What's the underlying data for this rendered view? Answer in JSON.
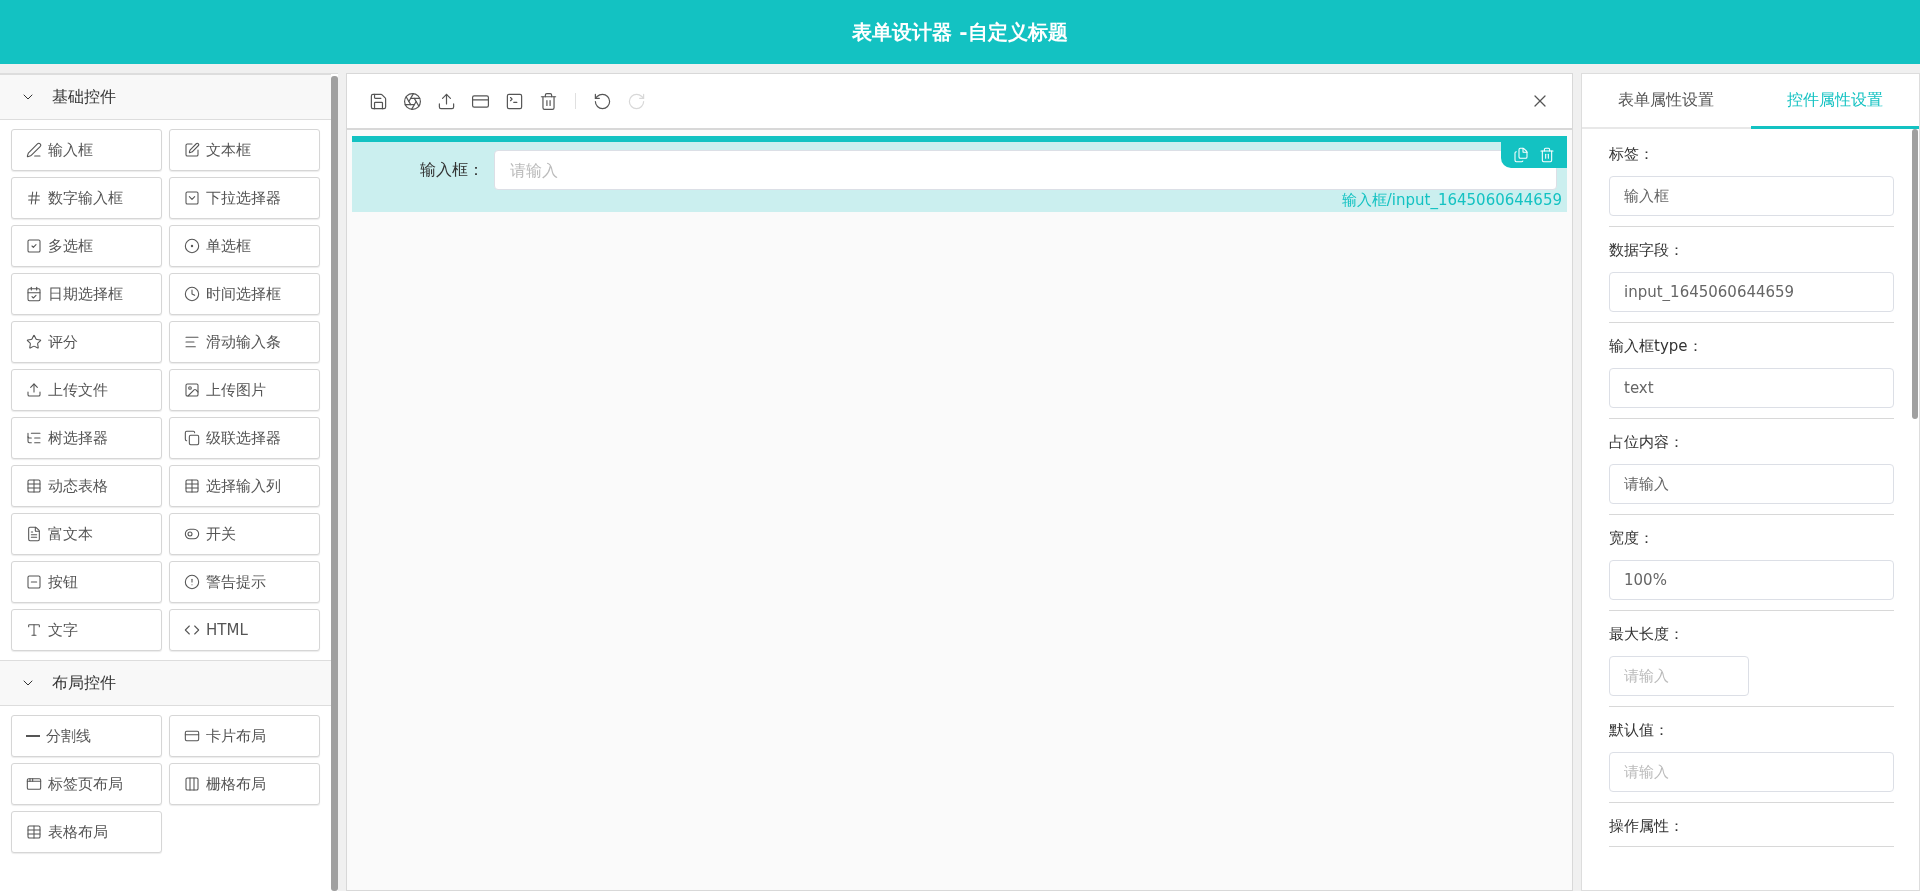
{
  "header": {
    "title": "表单设计器 -自定义标题"
  },
  "palette": {
    "sections": [
      {
        "title": "基础控件",
        "expanded": true,
        "widgets": [
          {
            "label": "输入框",
            "kind": "input"
          },
          {
            "label": "文本框",
            "kind": "textarea"
          },
          {
            "label": "数字输入框",
            "kind": "number"
          },
          {
            "label": "下拉选择器",
            "kind": "select"
          },
          {
            "label": "多选框",
            "kind": "checkbox"
          },
          {
            "label": "单选框",
            "kind": "radio"
          },
          {
            "label": "日期选择框",
            "kind": "date"
          },
          {
            "label": "时间选择框",
            "kind": "time"
          },
          {
            "label": "评分",
            "kind": "rate"
          },
          {
            "label": "滑动输入条",
            "kind": "slider"
          },
          {
            "label": "上传文件",
            "kind": "upload"
          },
          {
            "label": "上传图片",
            "kind": "image"
          },
          {
            "label": "树选择器",
            "kind": "tree"
          },
          {
            "label": "级联选择器",
            "kind": "cascader"
          },
          {
            "label": "动态表格",
            "kind": "table"
          },
          {
            "label": "选择输入列",
            "kind": "table"
          },
          {
            "label": "富文本",
            "kind": "editor"
          },
          {
            "label": "开关",
            "kind": "switch"
          },
          {
            "label": "按钮",
            "kind": "button"
          },
          {
            "label": "警告提示",
            "kind": "alert"
          },
          {
            "label": "文字",
            "kind": "text"
          },
          {
            "label": "HTML",
            "kind": "html"
          }
        ]
      },
      {
        "title": "布局控件",
        "expanded": true,
        "widgets": [
          {
            "label": "分割线",
            "kind": "divider"
          },
          {
            "label": "卡片布局",
            "kind": "card"
          },
          {
            "label": "标签页布局",
            "kind": "tabs"
          },
          {
            "label": "栅格布局",
            "kind": "grid"
          },
          {
            "label": "表格布局",
            "kind": "table"
          }
        ]
      }
    ]
  },
  "toolbar": {
    "buttons": [
      {
        "kind": "save",
        "disabled": false
      },
      {
        "kind": "preview",
        "disabled": false
      },
      {
        "kind": "import",
        "disabled": false
      },
      {
        "kind": "card",
        "disabled": false
      },
      {
        "kind": "code",
        "disabled": false
      },
      {
        "kind": "clear",
        "disabled": false
      },
      {
        "kind": "separator"
      },
      {
        "kind": "undo",
        "disabled": false
      },
      {
        "kind": "redo",
        "disabled": true
      }
    ]
  },
  "canvas": {
    "items": [
      {
        "label": "输入框：",
        "placeholder": "请输入",
        "key": "输入框/input_1645060644659",
        "selected": true
      }
    ]
  },
  "properties": {
    "tabs": [
      {
        "label": "表单属性设置",
        "selected": false
      },
      {
        "label": "控件属性设置",
        "selected": true
      }
    ],
    "fields": [
      {
        "label": "标签：",
        "value": "输入框",
        "kind": "text"
      },
      {
        "label": "数据字段：",
        "value": "input_1645060644659",
        "kind": "text"
      },
      {
        "label": "输入框type：",
        "value": "text",
        "kind": "text"
      },
      {
        "label": "占位内容：",
        "value": "请输入",
        "kind": "text"
      },
      {
        "label": "宽度：",
        "value": "100%",
        "kind": "text"
      },
      {
        "label": "最大长度：",
        "placeholder": "请输入",
        "kind": "number"
      },
      {
        "label": "默认值：",
        "placeholder": "请输入",
        "kind": "text"
      },
      {
        "label": "操作属性：",
        "kind": "group"
      }
    ]
  }
}
